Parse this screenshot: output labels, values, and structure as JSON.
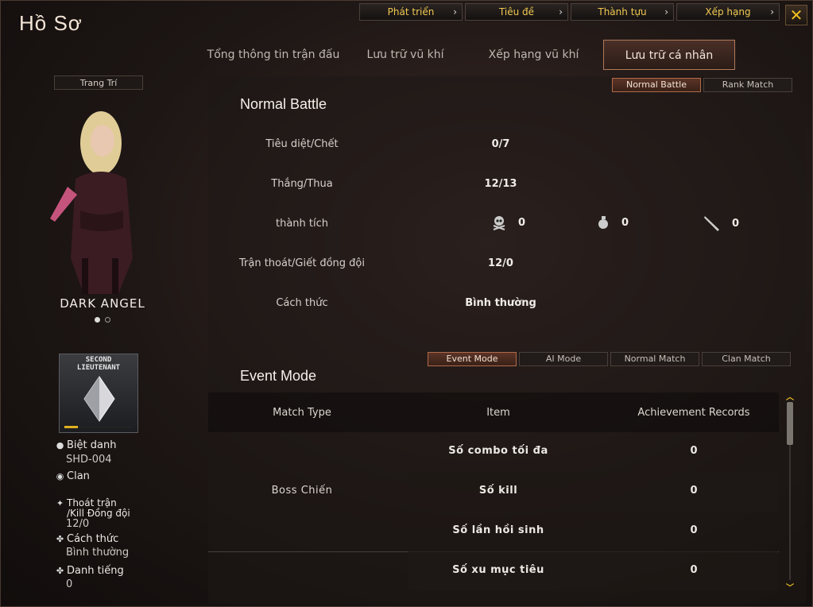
{
  "window": {
    "title": "Hồ Sơ"
  },
  "top_nav": [
    "Phát triển",
    "Tiêu đề",
    "Thành tựu",
    "Xếp hạng"
  ],
  "tabs": [
    "Tổng thông tin trận đấu",
    "Lưu trữ vũ khí",
    "Xếp hạng vũ khí",
    "Lưu trữ cá nhân"
  ],
  "active_tab": "Lưu trữ cá nhân",
  "character": {
    "decoration_button": "Trang Trí",
    "name": "DARK ANGEL",
    "rank_text_line1": "SECOND",
    "rank_text_line2": "LIEUTENANT",
    "rank_progress": 0.2
  },
  "profile": {
    "nickname_label": "Biệt danh",
    "nickname": "SHD-004",
    "clan_label": "Clan",
    "escape_label_1": "Thoát trận",
    "escape_label_2": "/Kill Đồng đội",
    "escape_value": "12/0",
    "style_label": "Cách thức",
    "style_value": "Bình thường",
    "reputation_label": "Danh tiếng",
    "reputation_value": "0"
  },
  "normal_battle": {
    "title": "Normal Battle",
    "mode_buttons": [
      "Normal Battle",
      "Rank Match"
    ],
    "active_mode": "Normal Battle",
    "stats": [
      {
        "label": "Tiêu diệt/Chết",
        "value": "0/7"
      },
      {
        "label": "Thắng/Thua",
        "value": "12/13"
      },
      {
        "label": "thành tích",
        "value": ""
      },
      {
        "label": "Trận thoát/Giết đồng đội",
        "value": "12/0"
      },
      {
        "label": "Cách thức",
        "value": "Bình thường"
      }
    ],
    "achievements": {
      "headshot": "0",
      "grenade": "0",
      "knife": "0"
    }
  },
  "event_mode": {
    "title": "Event Mode",
    "mode_buttons": [
      "Event Mode",
      "AI Mode",
      "Normal Match",
      "Clan Match"
    ],
    "active_mode": "Event Mode",
    "columns": [
      "Match Type",
      "Item",
      "Achievement Records"
    ],
    "group_label": "Boss Chiến",
    "rows": [
      {
        "item": "Số combo tối đa",
        "record": "0"
      },
      {
        "item": "Số kill",
        "record": "0"
      },
      {
        "item": "Số lần hồi sinh",
        "record": "0"
      },
      {
        "item": "Số xu mục tiêu",
        "record": "0"
      }
    ]
  },
  "icons": [
    "close-icon",
    "chevron-right-icon",
    "person-icon",
    "clan-icon",
    "runner-icon",
    "clover-icon",
    "skull-icon",
    "grenade-icon",
    "knife-icon",
    "scroll-up-icon",
    "scroll-down-icon"
  ],
  "colors": {
    "accent_gold": "#f0c850",
    "active_border": "#b07a5a",
    "background": "#1d1614"
  }
}
